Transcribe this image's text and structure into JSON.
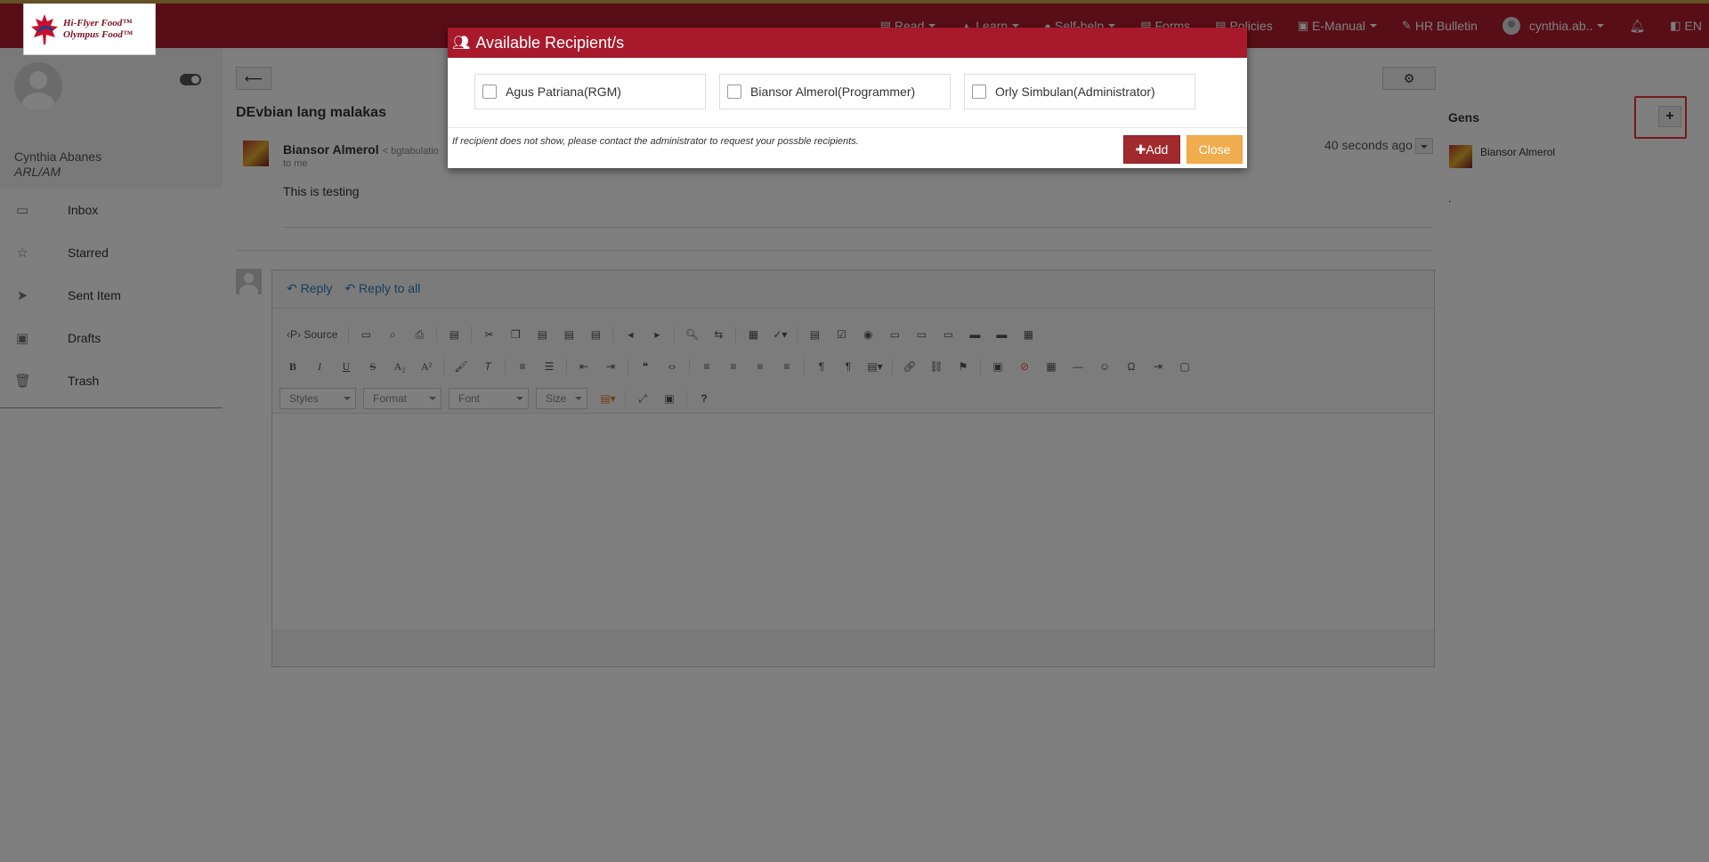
{
  "brand": {
    "line1": "Hi-Flyer Food™",
    "line2": "Olympus Food™"
  },
  "nav": {
    "items": [
      {
        "label": "Read",
        "icon": "book-icon",
        "dropdown": true
      },
      {
        "label": "Learn",
        "icon": "graduation-icon",
        "dropdown": true
      },
      {
        "label": "Self-help",
        "icon": "help-circle-icon",
        "dropdown": true
      },
      {
        "label": "Forms",
        "icon": "forms-icon",
        "dropdown": false
      },
      {
        "label": "Policies",
        "icon": "policies-icon",
        "dropdown": false
      },
      {
        "label": "E-Manual",
        "icon": "manual-icon",
        "dropdown": true
      },
      {
        "label": "HR Bulletin",
        "icon": "pin-icon",
        "dropdown": false
      }
    ],
    "user": "cynthia.ab..",
    "language": "EN"
  },
  "sidebar": {
    "name": "Cynthia Abanes",
    "role": "ARL/AM",
    "menu": [
      {
        "label": "Inbox",
        "icon": "inbox-icon"
      },
      {
        "label": "Starred",
        "icon": "star-icon"
      },
      {
        "label": "Sent Item",
        "icon": "paper-plane-icon"
      },
      {
        "label": "Drafts",
        "icon": "floppy-icon"
      },
      {
        "label": "Trash",
        "icon": "trash-icon"
      }
    ]
  },
  "message": {
    "subject": "DEvbian lang malakas",
    "from": "Biansor Almerol",
    "email": "< bgtabulatio",
    "to": "to me",
    "time": "40 seconds ago",
    "body": "This is testing"
  },
  "reply": {
    "reply_label": "Reply",
    "reply_all_label": "Reply to all"
  },
  "editor": {
    "source_label": "Source",
    "styles": "Styles",
    "format": "Format",
    "font": "Font",
    "size": "Size",
    "help": "?"
  },
  "gens": {
    "title": "Gens",
    "member": "Biansor Almerol",
    "extra": "."
  },
  "modal": {
    "title": "Available Recipient/s",
    "recipients": [
      {
        "label": "Agus Patriana(RGM)",
        "checked": false
      },
      {
        "label": "Biansor Almerol(Programmer)",
        "checked": false
      },
      {
        "label": "Orly Simbulan(Administrator)",
        "checked": false
      }
    ],
    "note": "If recipient does not show, please contact the administrator to request your possble recipients.",
    "add_label": "Add",
    "close_label": "Close"
  },
  "colors": {
    "navbar": "#b01c2e",
    "modal_header": "#a7192b",
    "add_button": "#a12a2e",
    "close_button": "#f0ad4e",
    "highlight": "#ee3333"
  }
}
